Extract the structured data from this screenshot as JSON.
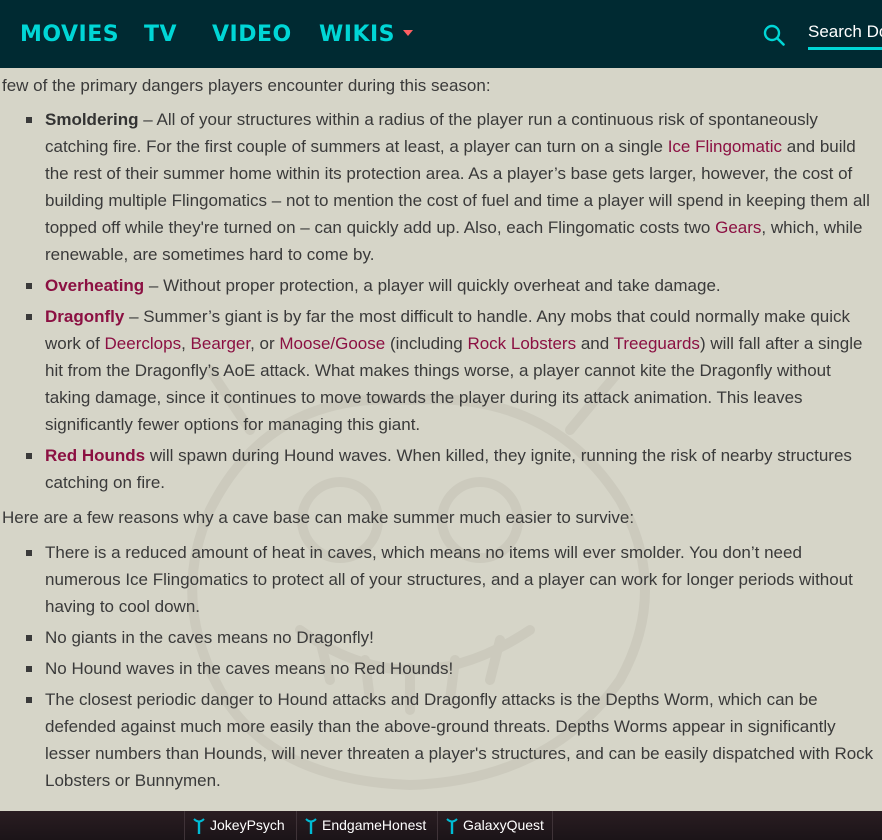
{
  "nav": {
    "items": [
      "MOVIES",
      "TV",
      "VIDEO",
      "WIKIS"
    ],
    "search_placeholder": "Search Do",
    "colors": {
      "background": "#002a32",
      "accent": "#00d6d6",
      "caret": "#fd5f62"
    }
  },
  "article": {
    "intro": "few of the primary dangers players encounter during this season:",
    "dangers": [
      {
        "term": "Smoldering",
        "text1": " – All of your structures within a radius of the player run a continuous risk of spontaneously catching fire. For the first couple of summers at least, a player can turn on a single ",
        "link1": "Ice Flingomatic",
        "text2": " and build the rest of their summer home within its protection area. As a player’s base gets larger, however, the cost of building multiple Flingomatics – not to mention the cost of fuel and time a player will spend in keeping them all topped off while they're turned on – can quickly add up. Also, each Flingomatic costs two ",
        "link2": "Gears",
        "text3": ", which, while renewable, are sometimes hard to come by."
      },
      {
        "term": "Overheating",
        "text1": " – Without proper protection, a player will quickly overheat and take damage."
      },
      {
        "term": "Dragonfly",
        "text1": " – Summer’s giant is by far the most difficult to handle. Any mobs that could normally make quick work of ",
        "link1": "Deerclops",
        "sep1": ", ",
        "link2": "Bearger",
        "sep2": ", or ",
        "link3": "Moose/Goose",
        "sep3": " (including ",
        "link4": "Rock Lobsters",
        "sep4": " and ",
        "link5": "Treeguards",
        "text2": ") will fall after a single hit from the Dragonfly’s AoE attack. What makes things worse, a player cannot kite the Dragonfly without taking damage, since it continues to move towards the player during its attack animation. This leaves significantly fewer options for managing this giant."
      },
      {
        "term": "Red Hounds",
        "text1": " will spawn during Hound waves. When killed, they ignite, running the risk of nearby structures catching on fire."
      }
    ],
    "reasons_intro": "Here are a few reasons why a cave base can make summer much easier to survive:",
    "reasons": [
      "There is a reduced amount of heat in caves, which means no items will ever smolder. You don’t need numerous Ice Flingomatics to protect all of your structures, and a player can work for longer periods without having to cool down.",
      "No giants in the caves means no Dragonfly!",
      "No Hound waves in the caves means no Red Hounds!",
      "The closest periodic danger to Hound attacks and Dragonfly attacks is the Depths Worm, which can be defended against much more easily than the above-ground threats. Depths Worms appear in significantly lesser numbers than Hounds, will never threaten a player's structures, and can be easily dispatched with Rock Lobsters or Bunnymen."
    ],
    "colors": {
      "background": "#d6d5c8",
      "text": "#3a3a3a",
      "link": "#8b1042"
    }
  },
  "bottombar": {
    "communities": [
      "JokeyPsych",
      "EndgameHonest",
      "GalaxyQuest"
    ],
    "icon": "wiki-antenna-icon"
  }
}
